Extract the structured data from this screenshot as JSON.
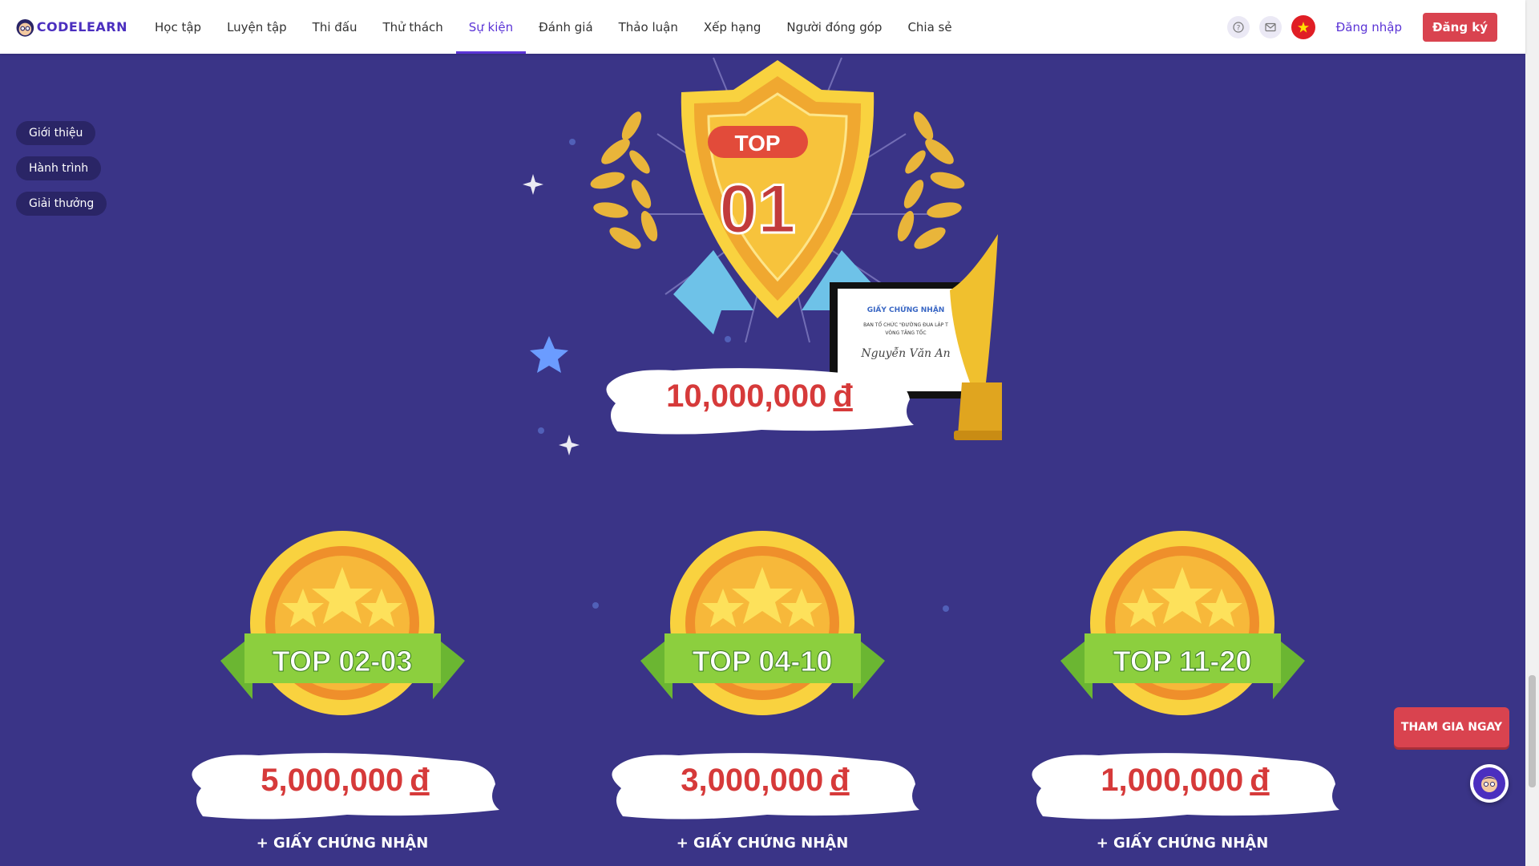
{
  "brand": {
    "name": "CODELEARN"
  },
  "nav": {
    "items": [
      "Học tập",
      "Luyện tập",
      "Thi đấu",
      "Thử thách",
      "Sự kiện",
      "Đánh giá",
      "Thảo luận",
      "Xếp hạng",
      "Người đóng góp",
      "Chia sẻ"
    ],
    "active": "Sự kiện"
  },
  "header": {
    "help_icon": "question-icon",
    "message_icon": "mail-icon",
    "language_flag": "vietnam-flag-icon",
    "login_label": "Đăng nhập",
    "signup_label": "Đăng ký"
  },
  "side_menu": [
    "Giới thiệu",
    "Hành trình",
    "Giải thưởng"
  ],
  "top_prize": {
    "badge_label": "TOP",
    "rank": "01",
    "amount": "10,000,000",
    "currency": "đ"
  },
  "prizes": [
    {
      "label": "TOP 02-03",
      "amount": "5,000,000",
      "currency": "đ",
      "extra": "+ GIẤY CHỨNG NHẬN"
    },
    {
      "label": "TOP 04-10",
      "amount": "3,000,000",
      "currency": "đ",
      "extra": "+ GIẤY CHỨNG NHẬN"
    },
    {
      "label": "TOP 11-20",
      "amount": "1,000,000",
      "currency": "đ",
      "extra": "+ GIẤY CHỨNG NHẬN"
    }
  ],
  "certificate": {
    "title": "GIẤY CHỨNG NHẬN",
    "line1": "BAN TỔ CHỨC \"ĐƯỜNG ĐUA LẬP T",
    "line2": "VÒNG TĂNG TỐC",
    "signature": "Nguyễn Văn An"
  },
  "cta": {
    "join_label": "THAM GIA NGAY"
  },
  "colors": {
    "background": "#3a3487",
    "accent": "#5b34d6",
    "red": "#d9434f",
    "amount": "#d63a3a"
  }
}
